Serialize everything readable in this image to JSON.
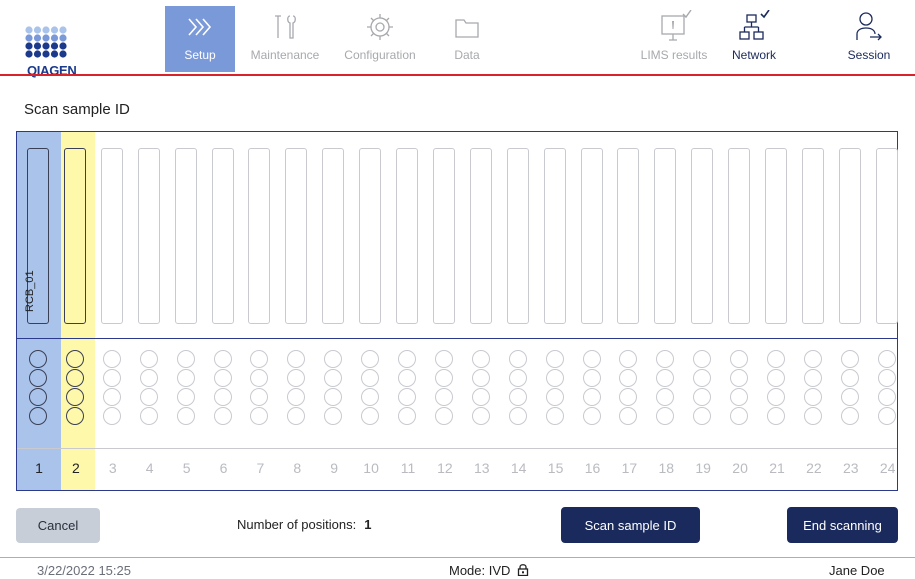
{
  "brand": {
    "logo_text": "QIAGEN",
    "accent": "#d8232a",
    "navy": "#1b2a5c",
    "active_tab": "#7a99d8"
  },
  "nav": {
    "setup": {
      "label": "Setup",
      "icon": "chevrons-right-icon"
    },
    "maintenance": {
      "label": "Maintenance",
      "icon": "tools-icon"
    },
    "configuration": {
      "label": "Configuration",
      "icon": "gear-icon"
    },
    "data": {
      "label": "Data",
      "icon": "folder-icon"
    },
    "lims": {
      "label": "LIMS results",
      "icon": "monitor-check-icon"
    },
    "network": {
      "label": "Network",
      "icon": "network-check-icon"
    },
    "session": {
      "label": "Session",
      "icon": "user-logout-icon"
    }
  },
  "page": {
    "title": "Scan sample ID"
  },
  "rack": {
    "columns": [
      "1",
      "2",
      "3",
      "4",
      "5",
      "6",
      "7",
      "8",
      "9",
      "10",
      "11",
      "12",
      "13",
      "14",
      "15",
      "16",
      "17",
      "18",
      "19",
      "20",
      "21",
      "22",
      "23",
      "24"
    ],
    "tube_1_label": "RCB_01",
    "selected_column": "1",
    "next_column": "2"
  },
  "actions": {
    "cancel": "Cancel",
    "positions_label": "Number of positions:",
    "positions_value": "1",
    "scan": "Scan sample ID",
    "end": "End scanning"
  },
  "status": {
    "datetime": "3/22/2022 15:25",
    "mode": "Mode: IVD",
    "mode_icon": "lock-icon",
    "user": "Jane Doe"
  }
}
